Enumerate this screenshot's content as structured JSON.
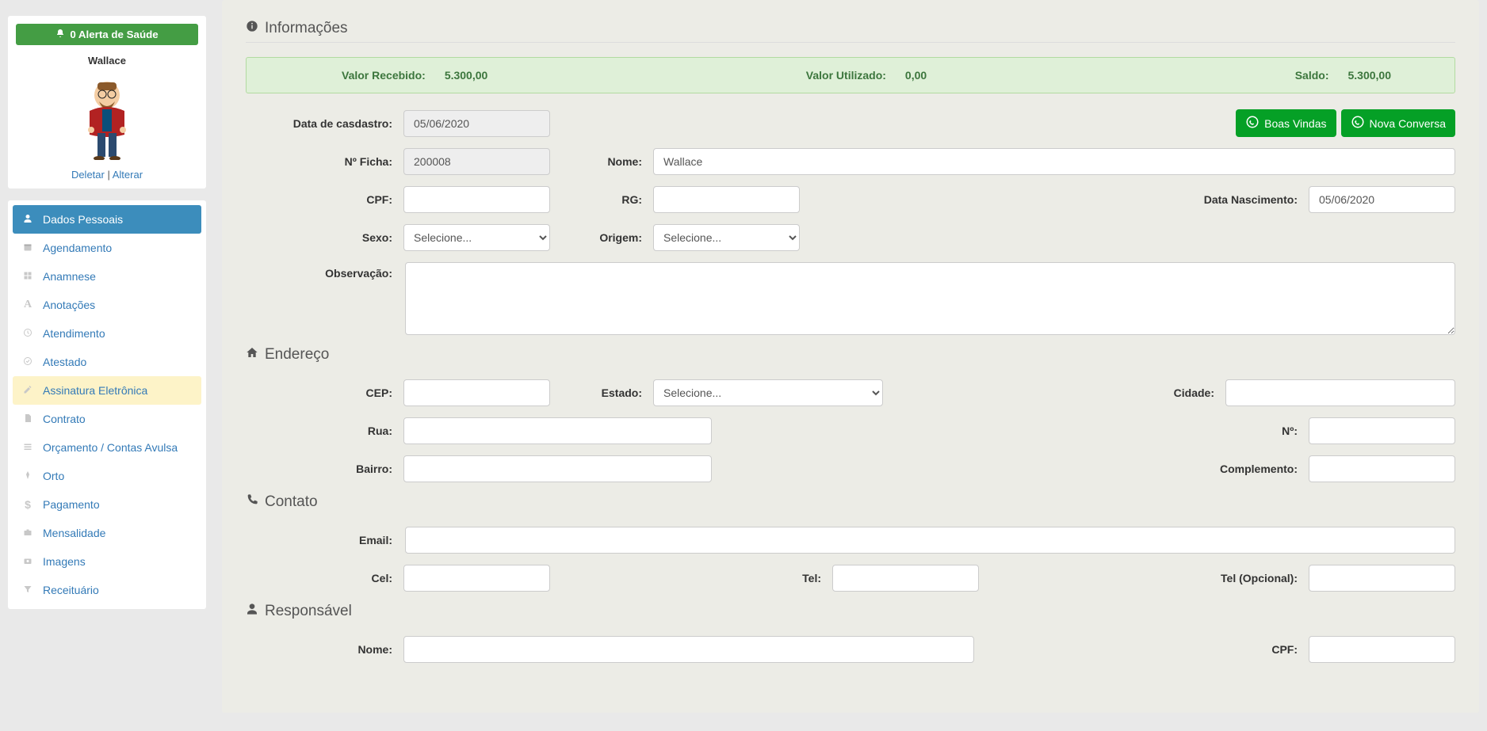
{
  "sidebar": {
    "health_alert": "0 Alerta de Saúde",
    "patient_name": "Wallace",
    "avatar_delete": "Deletar",
    "avatar_sep": " | ",
    "avatar_change": "Alterar",
    "nav": [
      {
        "label": "Dados Pessoais",
        "icon": "user"
      },
      {
        "label": "Agendamento",
        "icon": "calendar"
      },
      {
        "label": "Anamnese",
        "icon": "grid"
      },
      {
        "label": "Anotações",
        "icon": "font"
      },
      {
        "label": "Atendimento",
        "icon": "clock"
      },
      {
        "label": "Atestado",
        "icon": "check"
      },
      {
        "label": "Assinatura Eletrônica",
        "icon": "pencil"
      },
      {
        "label": "Contrato",
        "icon": "doc"
      },
      {
        "label": "Orçamento / Contas Avulsa",
        "icon": "list"
      },
      {
        "label": "Orto",
        "icon": "pin"
      },
      {
        "label": "Pagamento",
        "icon": "dollar"
      },
      {
        "label": "Mensalidade",
        "icon": "briefcase"
      },
      {
        "label": "Imagens",
        "icon": "camera"
      },
      {
        "label": "Receituário",
        "icon": "filter"
      }
    ]
  },
  "sections": {
    "info": "Informações",
    "address": "Endereço",
    "contact": "Contato",
    "responsible": "Responsável"
  },
  "balance": {
    "received_label": "Valor Recebido:",
    "received_value": "5.300,00",
    "used_label": "Valor Utilizado:",
    "used_value": "0,00",
    "saldo_label": "Saldo:",
    "saldo_value": "5.300,00"
  },
  "buttons": {
    "boas_vindas": "Boas Vindas",
    "nova_conversa": "Nova Conversa"
  },
  "form": {
    "data_cadastro_label": "Data de casdastro:",
    "data_cadastro_value": "05/06/2020",
    "ficha_label": "Nº Ficha:",
    "ficha_value": "200008",
    "nome_label": "Nome:",
    "nome_value": "Wallace",
    "cpf_label": "CPF:",
    "cpf_value": "",
    "rg_label": "RG:",
    "rg_value": "",
    "nasc_label": "Data Nascimento:",
    "nasc_value": "05/06/2020",
    "sexo_label": "Sexo:",
    "sexo_placeholder": "Selecione...",
    "origem_label": "Origem:",
    "origem_placeholder": "Selecione...",
    "obs_label": "Observação:",
    "obs_value": "",
    "cep_label": "CEP:",
    "cep_value": "",
    "estado_label": "Estado:",
    "estado_placeholder": "Selecione...",
    "cidade_label": "Cidade:",
    "cidade_value": "",
    "rua_label": "Rua:",
    "rua_value": "",
    "numero_label": "Nº:",
    "numero_value": "",
    "bairro_label": "Bairro:",
    "bairro_value": "",
    "complemento_label": "Complemento:",
    "complemento_value": "",
    "email_label": "Email:",
    "email_value": "",
    "cel_label": "Cel:",
    "cel_value": "",
    "tel_label": "Tel:",
    "tel_value": "",
    "tel2_label": "Tel (Opcional):",
    "tel2_value": "",
    "resp_nome_label": "Nome:",
    "resp_cpf_label": "CPF:"
  }
}
